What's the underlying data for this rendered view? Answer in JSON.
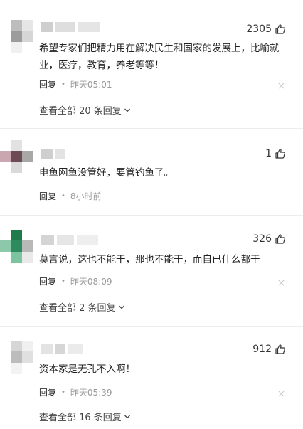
{
  "comments": [
    {
      "like_count": "2305",
      "content": "希望专家们把精力用在解决民生和国家的发展上，比喻就业，医疗，教育，养老等等！",
      "reply_label": "回复",
      "time": "昨天05:01",
      "more_replies": "查看全部 20 条回复"
    },
    {
      "like_count": "1",
      "content": "电鱼网鱼没管好，要管钓鱼了。",
      "reply_label": "回复",
      "time": "8小时前"
    },
    {
      "like_count": "326",
      "content": "莫言说，这也不能干，那也不能干，而自已什么都干",
      "reply_label": "回复",
      "time": "昨天08:09",
      "more_replies": "查看全部 2 条回复"
    },
    {
      "like_count": "912",
      "content": "资本家是无孔不入啊！",
      "reply_label": "回复",
      "time": "昨天05:39",
      "more_replies": "查看全部 16 条回复"
    }
  ],
  "colors": {
    "text": "#222222",
    "muted": "#999999",
    "divider": "#ededed"
  },
  "icons": {
    "like": "thumbs-up-icon",
    "close": "close-icon",
    "expand": "chevron-down-icon"
  }
}
